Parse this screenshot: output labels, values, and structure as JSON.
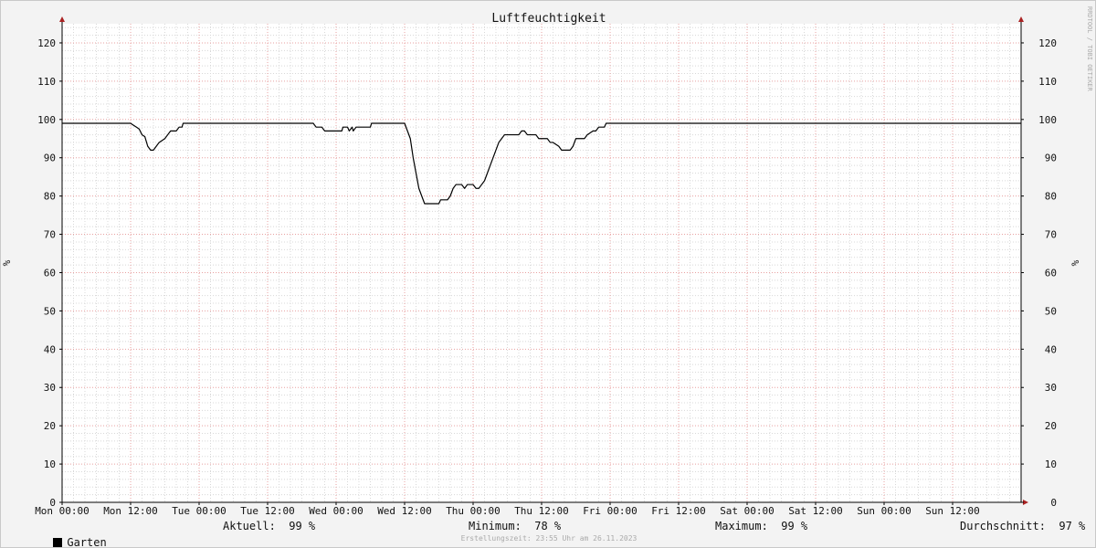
{
  "chart_data": {
    "type": "line",
    "title": "Luftfeuchtigkeit",
    "ylabel_left": "%",
    "ylabel_right": "%",
    "ylim": [
      0,
      125
    ],
    "yticks": [
      0,
      10,
      20,
      30,
      40,
      50,
      60,
      70,
      80,
      90,
      100,
      110,
      120
    ],
    "grid": true,
    "x_start_label": "Mon 00:00",
    "x_tick_labels": [
      "Mon 00:00",
      "Mon 12:00",
      "Tue 00:00",
      "Tue 12:00",
      "Wed 00:00",
      "Wed 12:00",
      "Thu 00:00",
      "Thu 12:00",
      "Fri 00:00",
      "Fri 12:00",
      "Sat 00:00",
      "Sat 12:00",
      "Sun 00:00",
      "Sun 12:00"
    ],
    "x_hours_range": [
      0,
      168
    ],
    "series": [
      {
        "name": "Garten",
        "color": "#000000",
        "points": [
          [
            0,
            99
          ],
          [
            12,
            99
          ],
          [
            12.5,
            98.5
          ],
          [
            13,
            98
          ],
          [
            13.5,
            97.5
          ],
          [
            14,
            96
          ],
          [
            14.5,
            95.5
          ],
          [
            15,
            93
          ],
          [
            15.5,
            92
          ],
          [
            16,
            92
          ],
          [
            16.5,
            93
          ],
          [
            17,
            94
          ],
          [
            17.5,
            94.5
          ],
          [
            18,
            95
          ],
          [
            18.5,
            96
          ],
          [
            19,
            97
          ],
          [
            20,
            97
          ],
          [
            20.5,
            98
          ],
          [
            21,
            98
          ],
          [
            21.2,
            99
          ],
          [
            44,
            99
          ],
          [
            44.5,
            98
          ],
          [
            45.5,
            98
          ],
          [
            46,
            97
          ],
          [
            48,
            97
          ],
          [
            49,
            97
          ],
          [
            49.2,
            98
          ],
          [
            50,
            98
          ],
          [
            50.3,
            97
          ],
          [
            50.8,
            98
          ],
          [
            51,
            97
          ],
          [
            51.5,
            98
          ],
          [
            53,
            98
          ],
          [
            54,
            98
          ],
          [
            54.2,
            99
          ],
          [
            60,
            99
          ],
          [
            60.5,
            97
          ],
          [
            61,
            95
          ],
          [
            61.5,
            90
          ],
          [
            62,
            86
          ],
          [
            62.5,
            82
          ],
          [
            63,
            80
          ],
          [
            63.5,
            78
          ],
          [
            65,
            78
          ],
          [
            66,
            78
          ],
          [
            66.3,
            79
          ],
          [
            67,
            79
          ],
          [
            67.5,
            79
          ],
          [
            68,
            80
          ],
          [
            68.5,
            82
          ],
          [
            69,
            83
          ],
          [
            70,
            83
          ],
          [
            70.5,
            82
          ],
          [
            71,
            83
          ],
          [
            72,
            83
          ],
          [
            72.5,
            82
          ],
          [
            73,
            82
          ],
          [
            73.5,
            83
          ],
          [
            74,
            84
          ],
          [
            74.5,
            86
          ],
          [
            75,
            88
          ],
          [
            75.5,
            90
          ],
          [
            76,
            92
          ],
          [
            76.5,
            94
          ],
          [
            77,
            95
          ],
          [
            77.5,
            96
          ],
          [
            78,
            96
          ],
          [
            79,
            96
          ],
          [
            80,
            96
          ],
          [
            80.5,
            97
          ],
          [
            81,
            97
          ],
          [
            81.5,
            96
          ],
          [
            82,
            96
          ],
          [
            83,
            96
          ],
          [
            83.5,
            95
          ],
          [
            84,
            95
          ],
          [
            85,
            95
          ],
          [
            85.5,
            94
          ],
          [
            86,
            94
          ],
          [
            87,
            93
          ],
          [
            87.5,
            92
          ],
          [
            88,
            92
          ],
          [
            89,
            92
          ],
          [
            89.5,
            93
          ],
          [
            90,
            95
          ],
          [
            91,
            95
          ],
          [
            91.5,
            95
          ],
          [
            92,
            96
          ],
          [
            93,
            97
          ],
          [
            93.5,
            97
          ],
          [
            94,
            98
          ],
          [
            95,
            98
          ],
          [
            95.3,
            99
          ],
          [
            168,
            99
          ]
        ]
      }
    ],
    "legend": {
      "entry_label": "Garten",
      "aktuell": "Aktuell:  99 %",
      "minimum": "Minimum:  78 %",
      "maximum": "Maximum:  99 %",
      "durchschnitt": "Durchschnitt:  97 %"
    },
    "footer": "Erstellungszeit: 23:55 Uhr am 26.11.2023",
    "watermark": "RRDTOOL / TOBI OETIKER",
    "colors": {
      "major_grid": "#e8a0a0",
      "minor_grid": "#d8d8d8",
      "axis": "#000000",
      "arrow": "#aa2222",
      "plot_bg": "#ffffff",
      "canvas_bg": "#f3f3f3"
    }
  }
}
